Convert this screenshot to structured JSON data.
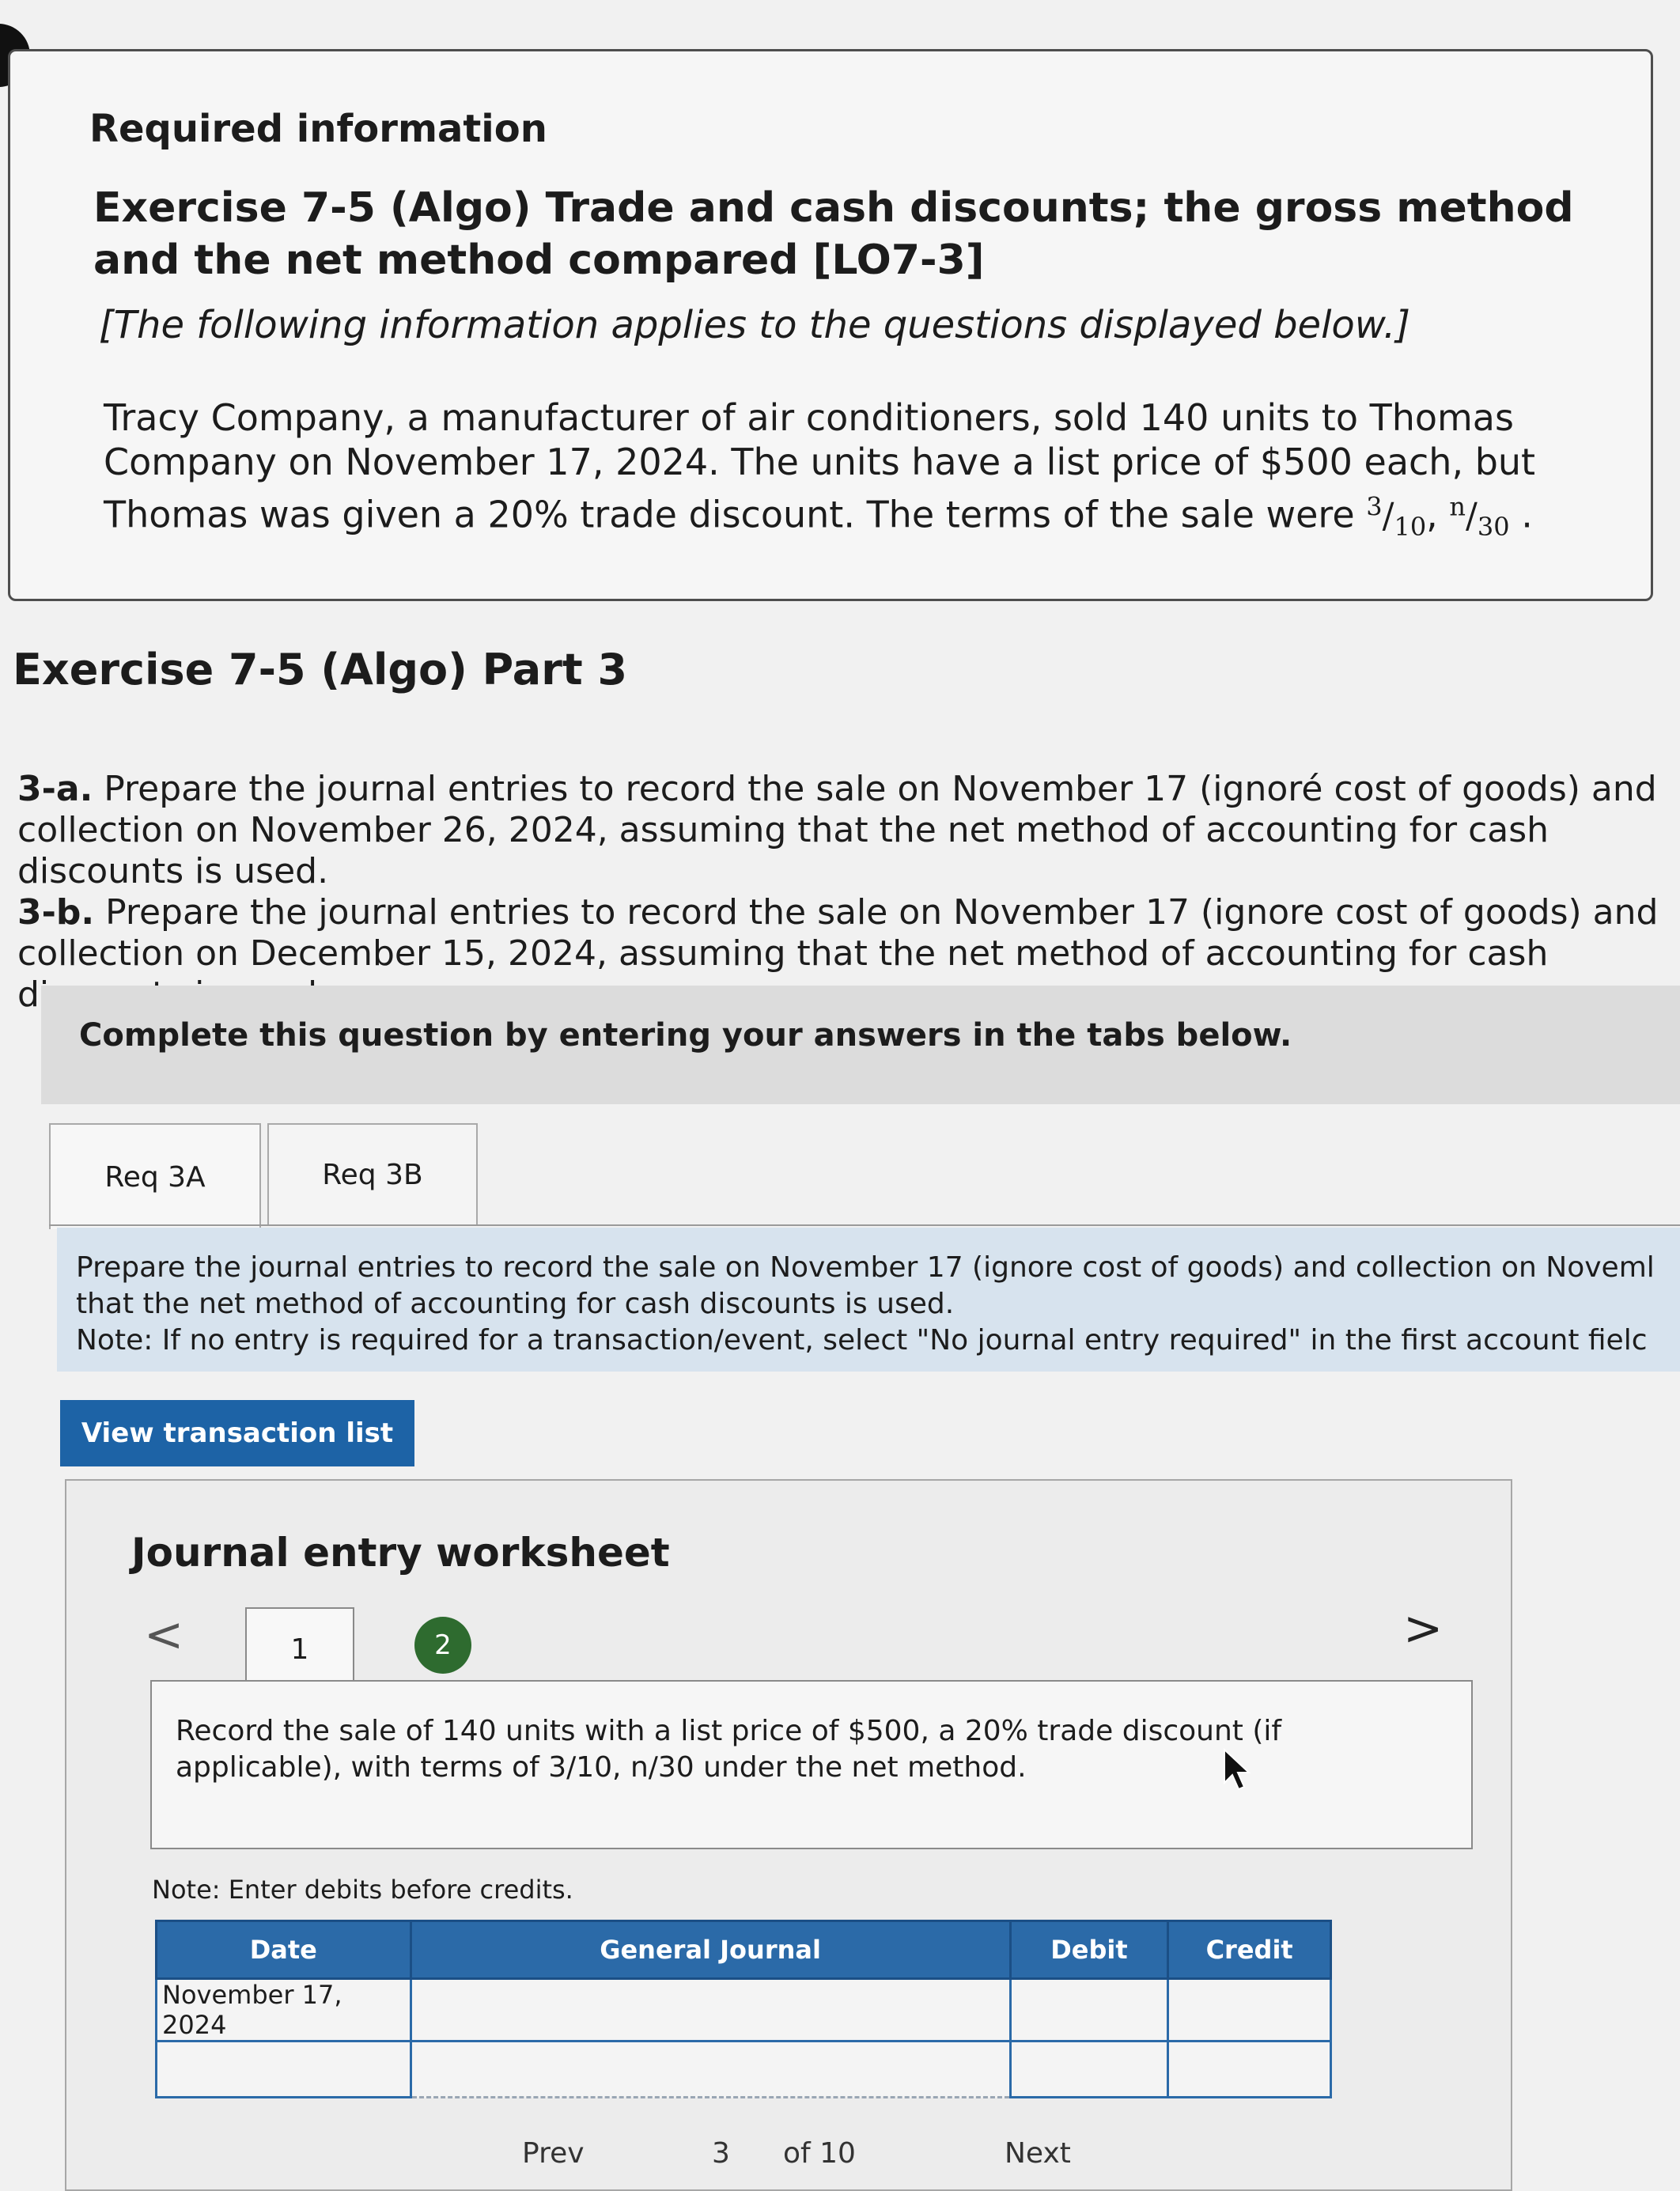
{
  "info": {
    "required_label": "Required information",
    "exercise_title": "Exercise 7-5 (Algo) Trade and cash discounts; the gross method and the net method compared [LO7-3]",
    "applies_note": "[The following information applies to the questions displayed below.]",
    "scenario": "Tracy Company, a manufacturer of air conditioners, sold 140 units to Thomas Company on November 17, 2024. The units have a list price of $500 each, but Thomas was given a 20% trade discount. The terms of the sale were",
    "terms_a_num": "3",
    "terms_a_den": "10",
    "terms_b_num": "n",
    "terms_b_den": "30"
  },
  "part_title": "Exercise 7-5 (Algo) Part 3",
  "instructions": {
    "a_label": "3-a.",
    "a_text": "Prepare the journal entries to record the sale on November 17 (ignoré cost of goods) and collection on November 26, 2024, assuming that the net method of accounting for cash discounts is used.",
    "b_label": "3-b.",
    "b_text": "Prepare the journal entries to record the sale on November 17 (ignore cost of goods) and collection on December 15, 2024, assuming that the net method of accounting for cash discounts is used."
  },
  "complete_banner": "Complete this question by entering your answers in the tabs below.",
  "tabs": [
    {
      "label": "Req 3A"
    },
    {
      "label": "Req 3B"
    }
  ],
  "prompt": {
    "line1": "Prepare the journal entries to record the sale on November 17 (ignore cost of goods) and collection on Noveml",
    "line2": "that the net method of accounting for cash discounts is used.",
    "line3": "Note: If no entry is required for a transaction/event, select \"No journal entry required\" in the first account fielc"
  },
  "view_button": "View transaction list",
  "worksheet": {
    "title": "Journal entry worksheet",
    "prev_arrow": "<",
    "next_arrow": ">",
    "steps": [
      "1",
      "2"
    ],
    "record_text": "Record the sale of 140 units with a list price of $500, a 20% trade discount (if applicable), with terms of 3/10, n/30 under the net method.",
    "note": "Note: Enter debits before credits.",
    "table": {
      "headers": [
        "Date",
        "General Journal",
        "Debit",
        "Credit"
      ],
      "rows": [
        {
          "date": "November 17, 2024",
          "account": "",
          "debit": "",
          "credit": ""
        },
        {
          "date": "",
          "account": "",
          "debit": "",
          "credit": ""
        }
      ]
    }
  },
  "footer": {
    "prev": "Prev",
    "page": "3",
    "of": "of 10",
    "next": "Next"
  }
}
